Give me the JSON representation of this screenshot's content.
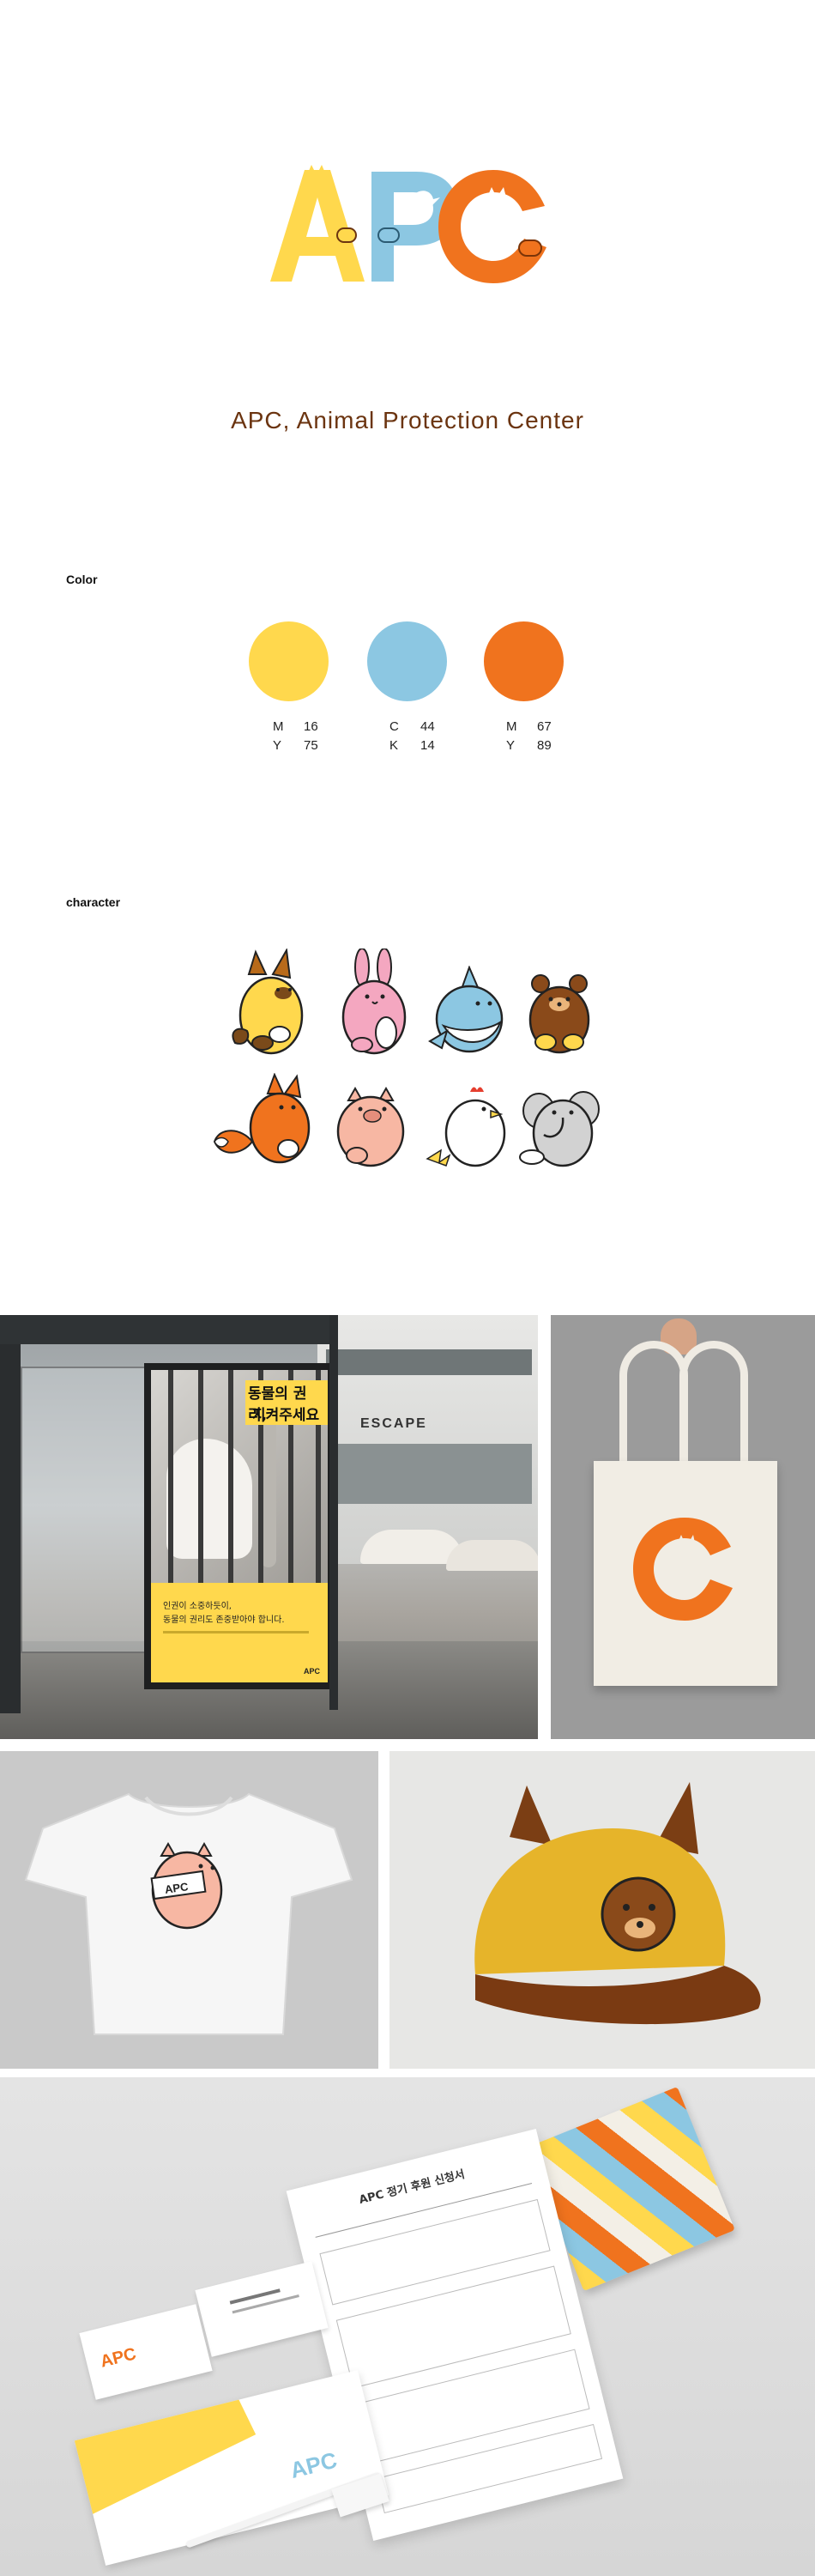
{
  "brand": {
    "logo_text": "APC",
    "tagline": "APC, Animal Protection Center",
    "colors": {
      "yellow": "#FFD84D",
      "blue": "#8CC7E2",
      "orange": "#F0731E",
      "brown": "#6B3410"
    }
  },
  "color_section": {
    "label": "Color",
    "swatches": [
      {
        "hex": "#FFD84D",
        "line1": "M",
        "val1": "16",
        "line2": "Y",
        "val2": "75"
      },
      {
        "hex": "#8CC7E2",
        "line1": "C",
        "val1": "44",
        "line2": "K",
        "val2": "14"
      },
      {
        "hex": "#F0731E",
        "line1": "M",
        "val1": "67",
        "line2": "Y",
        "val2": "89"
      }
    ]
  },
  "character_section": {
    "label": "character",
    "characters": [
      "fox-yellow",
      "rabbit-pink",
      "shark-blue",
      "bear-brown",
      "fox-orange",
      "pig-pink",
      "chicken-white",
      "elephant-gray"
    ]
  },
  "mockups": {
    "poster": {
      "headline1": "동물의 권리,",
      "headline2": "지켜주세요",
      "body1": "인권이 소중하듯이,",
      "body2": "동물의 권리도 존중받아야 합니다.",
      "logo": "APC",
      "sign_text": "ESCAPE"
    },
    "tote": {
      "letter": "C"
    },
    "tshirt": {
      "badge": "APC"
    },
    "stationery": {
      "form_title": "APC 정기 후원 신청서",
      "card_logo": "APC",
      "envelope_logo": "APC"
    }
  }
}
